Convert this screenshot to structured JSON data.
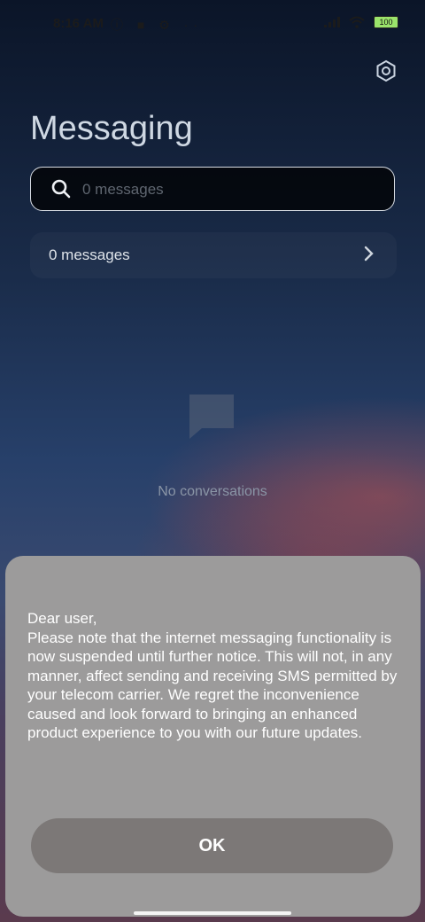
{
  "status": {
    "time": "8:16 AM",
    "battery": "100",
    "left_icons": "ⓘ ■ ⚙ ··"
  },
  "header": {
    "title": "Messaging"
  },
  "search": {
    "placeholder": "0 messages"
  },
  "list": {
    "row_label": "0 messages"
  },
  "empty": {
    "text": "No conversations"
  },
  "dialog": {
    "body": "Dear user,\nPlease note that the internet messaging functionality is now suspended until further notice. This will not, in any manner, affect sending and receiving SMS permitted by your telecom carrier. We regret the inconvenience caused and look forward to bringing an enhanced product experience to you with our future updates.",
    "ok_label": "OK"
  },
  "icons": [
    "settings-icon",
    "search-icon",
    "chevron-right-icon",
    "chat-bubble-icon",
    "wifi-icon",
    "signal-icon",
    "battery-icon"
  ],
  "colors": {
    "dialog_bg": "#9c9b9b",
    "ok_button": "#7c7877"
  }
}
